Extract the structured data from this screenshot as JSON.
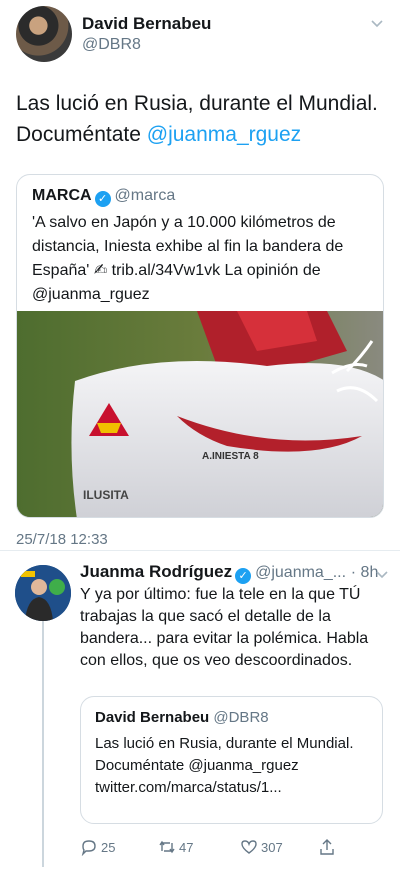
{
  "main_tweet": {
    "author_name": "David Bernabeu",
    "author_handle": "@DBR8",
    "text_plain": "Las lució en Rusia, durante el Mundial. Documéntate ",
    "text_mention": "@juanma_rguez",
    "timestamp": "25/7/18 12:33"
  },
  "quoted_tweet": {
    "author_name": "MARCA",
    "author_handle": "@marca",
    "text": "'A salvo en Japón y a 10.000 kilómetros de distancia, Iniesta exhibe al fin la bandera de España' ✍ trib.al/34Vw1vk La opinión de @juanma_rguez",
    "image_text_name": "A.INIESTA 8",
    "image_text_logo": "ILUSITA"
  },
  "reply_tweet": {
    "author_name": "Juanma Rodríguez",
    "author_handle": "@juanma_...",
    "time": "· 8h",
    "text": "Y ya por último: fue la tele en la que TÚ trabajas la que sacó el detalle de la bandera... para evitar la polémica. Habla con ellos, que os veo descoordinados.",
    "quoted": {
      "author_name": "David Bernabeu",
      "author_handle": "@DBR8",
      "text": "Las lució en Rusia, durante el Mundial. Documéntate @juanma_rguez twitter.com/marca/status/1..."
    },
    "actions": {
      "replies": "25",
      "retweets": "47",
      "likes": "307"
    }
  },
  "colors": {
    "link": "#1da1f2",
    "secondary": "#657786",
    "border": "#d6dde3"
  },
  "icons": [
    "chevron-down-icon",
    "verified-badge-icon",
    "reply-icon",
    "retweet-icon",
    "like-icon",
    "share-icon"
  ]
}
